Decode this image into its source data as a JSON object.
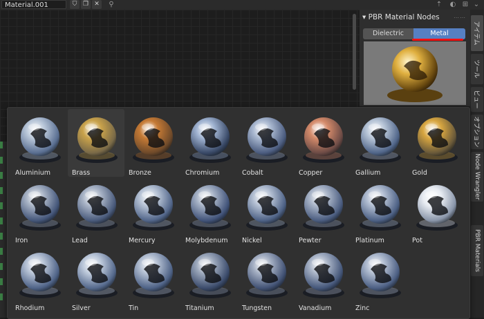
{
  "header": {
    "material_name": "Material.001"
  },
  "panel": {
    "title": "PBR Material Nodes",
    "tabs": [
      {
        "label": "Dielectric",
        "active": false
      },
      {
        "label": "Metal",
        "active": true
      }
    ]
  },
  "vertical_tabs": [
    "アイテム",
    "ツール",
    "ビュー",
    "オプション",
    "Node Wrangler",
    "PBR Materials"
  ],
  "materials": [
    {
      "name": "Aluminium",
      "tint": "#b8c6d8",
      "bg": "#5a6f92"
    },
    {
      "name": "Brass",
      "tint": "#c9a24a",
      "bg": "#7a6a48"
    },
    {
      "name": "Bronze",
      "tint": "#c57a35",
      "bg": "#6f4a2a"
    },
    {
      "name": "Chromium",
      "tint": "#9fb2d0",
      "bg": "#3a4a68"
    },
    {
      "name": "Cobalt",
      "tint": "#a8b7cf",
      "bg": "#4c5d80"
    },
    {
      "name": "Copper",
      "tint": "#d48a6a",
      "bg": "#6e4c46"
    },
    {
      "name": "Gallium",
      "tint": "#b6c4d6",
      "bg": "#51668a"
    },
    {
      "name": "Gold",
      "tint": "#d8a640",
      "bg": "#6a5a3a"
    },
    {
      "name": "Iron",
      "tint": "#a7b2c4",
      "bg": "#45577a"
    },
    {
      "name": "Lead",
      "tint": "#a9b4c6",
      "bg": "#4a5b7c"
    },
    {
      "name": "Mercury",
      "tint": "#b7c3d5",
      "bg": "#52668a"
    },
    {
      "name": "Molybdenum",
      "tint": "#a4b0c4",
      "bg": "#42547a"
    },
    {
      "name": "Nickel",
      "tint": "#b3bfd2",
      "bg": "#4e6286"
    },
    {
      "name": "Pewter",
      "tint": "#aab5c8",
      "bg": "#4b5d80"
    },
    {
      "name": "Platinum",
      "tint": "#b0bcd0",
      "bg": "#4d6185"
    },
    {
      "name": "Pot",
      "tint": "#e8ecf2",
      "bg": "#8a96aa"
    },
    {
      "name": "Rhodium",
      "tint": "#b5c1d4",
      "bg": "#4f6387"
    },
    {
      "name": "Silver",
      "tint": "#bcc8da",
      "bg": "#55698c"
    },
    {
      "name": "Tin",
      "tint": "#b2bed1",
      "bg": "#4e6286"
    },
    {
      "name": "Titanium",
      "tint": "#9aa6ba",
      "bg": "#3c4c6c"
    },
    {
      "name": "Tungsten",
      "tint": "#a3aec2",
      "bg": "#425274"
    },
    {
      "name": "Vanadium",
      "tint": "#a8b3c6",
      "bg": "#45577a"
    },
    {
      "name": "Zinc",
      "tint": "#afbbcf",
      "bg": "#4c5f83"
    }
  ],
  "preview": {
    "name": "Metal preview",
    "tint": "#d8a640",
    "bg": "#8a8a8a"
  },
  "colors": {
    "accent": "#5680c2",
    "highlight_underline": "#ff1010"
  }
}
